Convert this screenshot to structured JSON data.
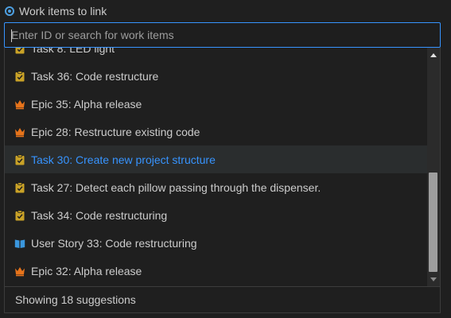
{
  "header": {
    "title": "Work items to link"
  },
  "search": {
    "value": "",
    "placeholder": "Enter ID or search for work items"
  },
  "colors": {
    "accent": "#3794ff",
    "task_icon": "#c9a227",
    "epic_icon": "#e8741b",
    "story_icon": "#3a96dd"
  },
  "items": [
    {
      "type": "task",
      "icon": "clipboard-check-icon",
      "label": "Task 8: LED light",
      "selected": false
    },
    {
      "type": "task",
      "icon": "clipboard-check-icon",
      "label": "Task 36: Code restructure",
      "selected": false
    },
    {
      "type": "epic",
      "icon": "crown-icon",
      "label": "Epic 35: Alpha release",
      "selected": false
    },
    {
      "type": "epic",
      "icon": "crown-icon",
      "label": "Epic 28: Restructure existing code",
      "selected": false
    },
    {
      "type": "task",
      "icon": "clipboard-check-icon",
      "label": "Task 30: Create new project structure",
      "selected": true
    },
    {
      "type": "task",
      "icon": "clipboard-check-icon",
      "label": "Task 27: Detect each pillow passing through the dispenser.",
      "selected": false
    },
    {
      "type": "task",
      "icon": "clipboard-check-icon",
      "label": "Task 34: Code restructuring",
      "selected": false
    },
    {
      "type": "story",
      "icon": "book-icon",
      "label": "User Story 33: Code restructuring",
      "selected": false
    },
    {
      "type": "epic",
      "icon": "crown-icon",
      "label": "Epic 32: Alpha release",
      "selected": false
    }
  ],
  "footer": {
    "status": "Showing 18 suggestions"
  }
}
